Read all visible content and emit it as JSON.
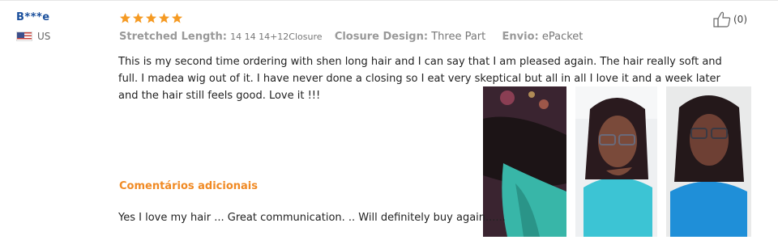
{
  "reviewer": {
    "name": "B***e",
    "country": "US"
  },
  "rating": {
    "stars": 5,
    "max": 5
  },
  "attributes": [
    {
      "key": "Stretched Length:",
      "value": "14 14 14+12Closure"
    },
    {
      "key": "Closure Design:",
      "value": "Three Part"
    },
    {
      "key": "Envio:",
      "value": "ePacket"
    }
  ],
  "review_text": "This is my second time ordering with  shen long   hair and I can say that I am pleased again. The hair really soft and full. I  madea wig out of it. I have never done a closing so I eat very skeptical but all in all I love it and a week later and the hair still feels good. Love it !!!",
  "additional": {
    "title": "Comentários adicionais",
    "text": "Yes I love my hair ... Great communication. .. Will definitely buy again......"
  },
  "helpful": {
    "count": "(0)"
  },
  "colors": {
    "star": "#f59a23",
    "name": "#1a4f9c",
    "additional_title": "#f08a24"
  }
}
